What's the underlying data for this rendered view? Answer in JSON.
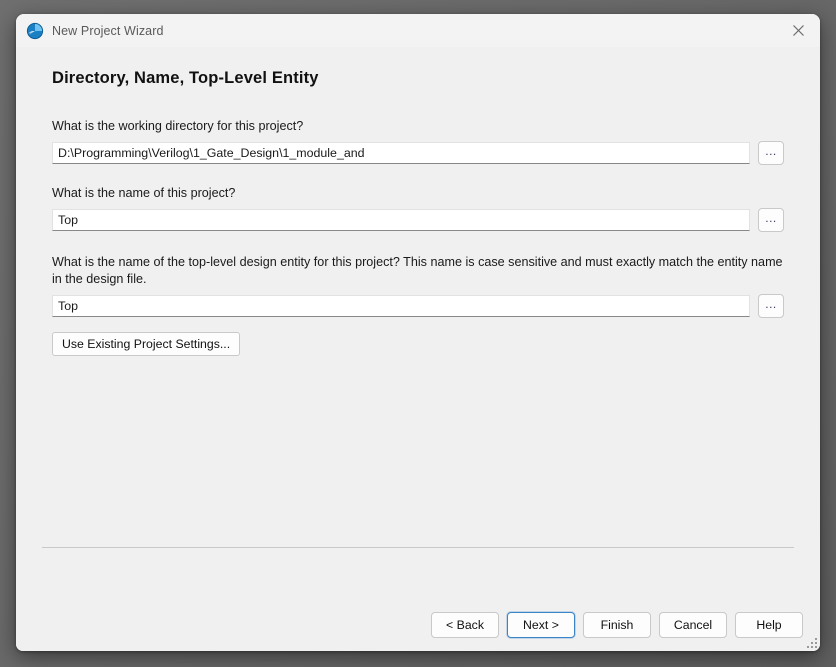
{
  "window": {
    "title": "New Project Wizard",
    "icon": "globe-icon",
    "close_label": "×"
  },
  "page": {
    "heading": "Directory, Name, Top-Level Entity"
  },
  "fields": [
    {
      "label": "What is the working directory for this project?",
      "value": "D:\\Programming\\Verilog\\1_Gate_Design\\1_module_and",
      "browse_label": "...",
      "placeholder": ""
    },
    {
      "label": "What is the name of this project?",
      "value": "Top",
      "browse_label": "...",
      "placeholder": ""
    },
    {
      "label": "What is the name of the top-level design entity for this project? This name is case sensitive and must exactly match the entity name in the design file.",
      "value": "Top",
      "browse_label": "...",
      "placeholder": ""
    }
  ],
  "actions": {
    "use_existing": "Use Existing Project Settings..."
  },
  "footer": {
    "buttons": [
      {
        "label": "< Back",
        "default": false
      },
      {
        "label": "Next >",
        "default": true
      },
      {
        "label": "Finish",
        "default": false
      },
      {
        "label": "Cancel",
        "default": false
      },
      {
        "label": "Help",
        "default": false
      }
    ]
  },
  "colors": {
    "accent": "#3a85c8",
    "window_bg": "#f0f0f0",
    "titlebar_bg": "#f3f3f3",
    "backdrop": "#676767"
  }
}
